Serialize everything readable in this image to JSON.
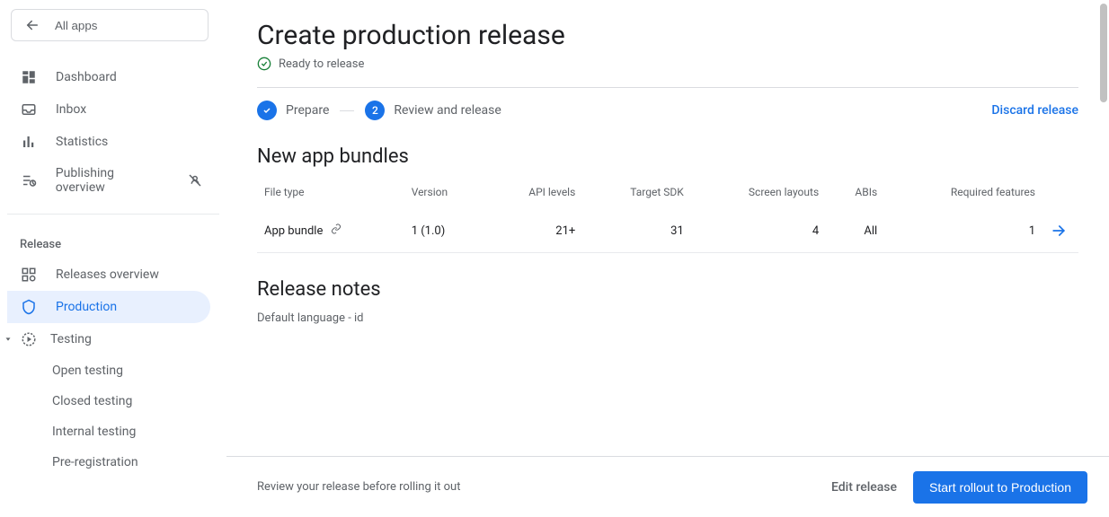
{
  "sidebar": {
    "all_apps": "All apps",
    "items": [
      {
        "label": "Dashboard"
      },
      {
        "label": "Inbox"
      },
      {
        "label": "Statistics"
      },
      {
        "label": "Publishing overview"
      }
    ],
    "release_section": "Release",
    "release_items": {
      "overview": "Releases overview",
      "production": "Production",
      "testing": "Testing",
      "open_testing": "Open testing",
      "closed_testing": "Closed testing",
      "internal_testing": "Internal testing",
      "pre_registration": "Pre-registration"
    }
  },
  "main": {
    "title": "Create production release",
    "ready": "Ready to release",
    "steps": {
      "prepare": "Prepare",
      "review": "Review and release"
    },
    "discard": "Discard release",
    "bundles_title": "New app bundles",
    "table": {
      "headers": {
        "file_type": "File type",
        "version": "Version",
        "api_levels": "API levels",
        "target_sdk": "Target SDK",
        "screen_layouts": "Screen layouts",
        "abis": "ABIs",
        "required_features": "Required features"
      },
      "rows": [
        {
          "file_type": "App bundle",
          "version": "1 (1.0)",
          "api_levels": "21+",
          "target_sdk": "31",
          "screen_layouts": "4",
          "abis": "All",
          "required_features": "1"
        }
      ]
    },
    "notes_title": "Release notes",
    "notes_lang": "Default language - id"
  },
  "footer": {
    "message": "Review your release before rolling it out",
    "edit": "Edit release",
    "rollout": "Start rollout to Production"
  }
}
